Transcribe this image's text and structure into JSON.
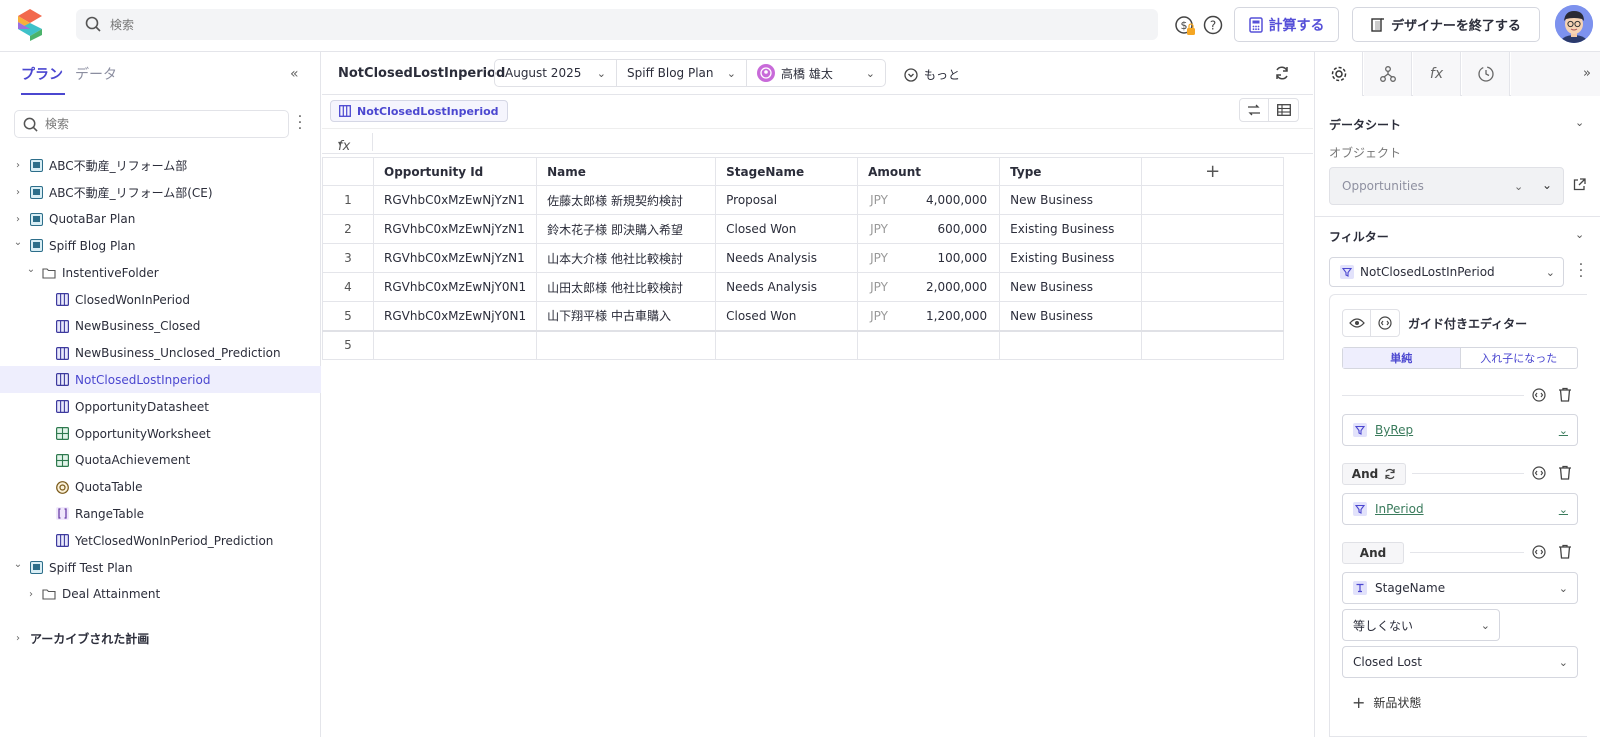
{
  "topbar": {
    "search_placeholder": "検索",
    "calc_label": "計算する",
    "exit_label": "デザイナーを終了する"
  },
  "left": {
    "tab_plan": "プラン",
    "tab_data": "データ",
    "search_placeholder": "検索",
    "tree": [
      {
        "label": "ABC不動産_リフォーム部",
        "level": 0,
        "chev": "right",
        "icon": "plan"
      },
      {
        "label": "ABC不動産_リフォーム部(CE)",
        "level": 0,
        "chev": "right",
        "icon": "plan"
      },
      {
        "label": "QuotaBar Plan",
        "level": 0,
        "chev": "right",
        "icon": "plan"
      },
      {
        "label": "Spiff Blog Plan",
        "level": 0,
        "chev": "down",
        "icon": "plan"
      },
      {
        "label": "InstentiveFolder",
        "level": 1,
        "chev": "down",
        "icon": "folder"
      },
      {
        "label": "ClosedWonInPeriod",
        "level": 2,
        "chev": "",
        "icon": "datasheet"
      },
      {
        "label": "NewBusiness_Closed",
        "level": 2,
        "chev": "",
        "icon": "datasheet"
      },
      {
        "label": "NewBusiness_Unclosed_Prediction",
        "level": 2,
        "chev": "",
        "icon": "datasheet"
      },
      {
        "label": "NotClosedLostInperiod",
        "level": 2,
        "chev": "",
        "icon": "datasheet",
        "selected": true
      },
      {
        "label": "OpportunityDatasheet",
        "level": 2,
        "chev": "",
        "icon": "datasheet"
      },
      {
        "label": "OpportunityWorksheet",
        "level": 2,
        "chev": "",
        "icon": "worksheet"
      },
      {
        "label": "QuotaAchievement",
        "level": 2,
        "chev": "",
        "icon": "worksheet"
      },
      {
        "label": "QuotaTable",
        "level": 2,
        "chev": "",
        "icon": "quota"
      },
      {
        "label": "RangeTable",
        "level": 2,
        "chev": "",
        "icon": "range"
      },
      {
        "label": "YetClosedWonInPeriod_Prediction",
        "level": 2,
        "chev": "",
        "icon": "datasheet"
      },
      {
        "label": "Spiff Test Plan",
        "level": 0,
        "chev": "down",
        "icon": "plan"
      },
      {
        "label": "Deal Attainment",
        "level": 1,
        "chev": "right",
        "icon": "folder"
      }
    ],
    "archived": "アーカイブされた計画"
  },
  "main": {
    "title": "NotClosedLostInperiod",
    "period": "August 2025",
    "plan": "Spiff Blog Plan",
    "user": "高橋 雄太",
    "more": "もっと",
    "tag": "NotClosedLostInperiod",
    "fx": "fx",
    "columns": [
      "Opportunity Id",
      "Name",
      "StageName",
      "Amount",
      "Type"
    ],
    "rows": [
      {
        "n": "1",
        "id": "RGVhbC0xMzEwNjYzN1",
        "name": "佐藤太郎様 新規契約検討",
        "stage": "Proposal",
        "cur": "JPY",
        "amt": "4,000,000",
        "type": "New Business"
      },
      {
        "n": "2",
        "id": "RGVhbC0xMzEwNjYzN1",
        "name": "鈴木花子様 即決購入希望",
        "stage": "Closed Won",
        "cur": "JPY",
        "amt": "600,000",
        "type": "Existing Business"
      },
      {
        "n": "3",
        "id": "RGVhbC0xMzEwNjYzN1",
        "name": "山本大介様 他社比較検討",
        "stage": "Needs Analysis",
        "cur": "JPY",
        "amt": "100,000",
        "type": "Existing Business"
      },
      {
        "n": "4",
        "id": "RGVhbC0xMzEwNjY0N1",
        "name": "山田太郎様 他社比較検討",
        "stage": "Needs Analysis",
        "cur": "JPY",
        "amt": "2,000,000",
        "type": "New Business"
      },
      {
        "n": "5",
        "id": "RGVhbC0xMzEwNjY0N1",
        "name": "山下翔平様 中古車購入",
        "stage": "Closed Won",
        "cur": "JPY",
        "amt": "1,200,000",
        "type": "New Business"
      }
    ],
    "row_count": "5"
  },
  "right": {
    "datasheet_title": "データシート",
    "object_label": "オブジェクト",
    "object_value": "Opportunities",
    "filter_title": "フィルター",
    "filter_value": "NotClosedLostInPeriod",
    "guided_editor": "ガイド付きエディター",
    "mode_simple": "単純",
    "mode_nested": "入れ子になった",
    "cond1": "ByRep",
    "and1": "And",
    "cond2": "InPeriod",
    "and2": "And",
    "cond3_field": "StageName",
    "cond3_op": "等しくない",
    "cond3_value": "Closed Lost",
    "add_new": "新品状態"
  },
  "colors": {
    "accent": "#4b47d0",
    "link_green": "#3a7b5c"
  }
}
